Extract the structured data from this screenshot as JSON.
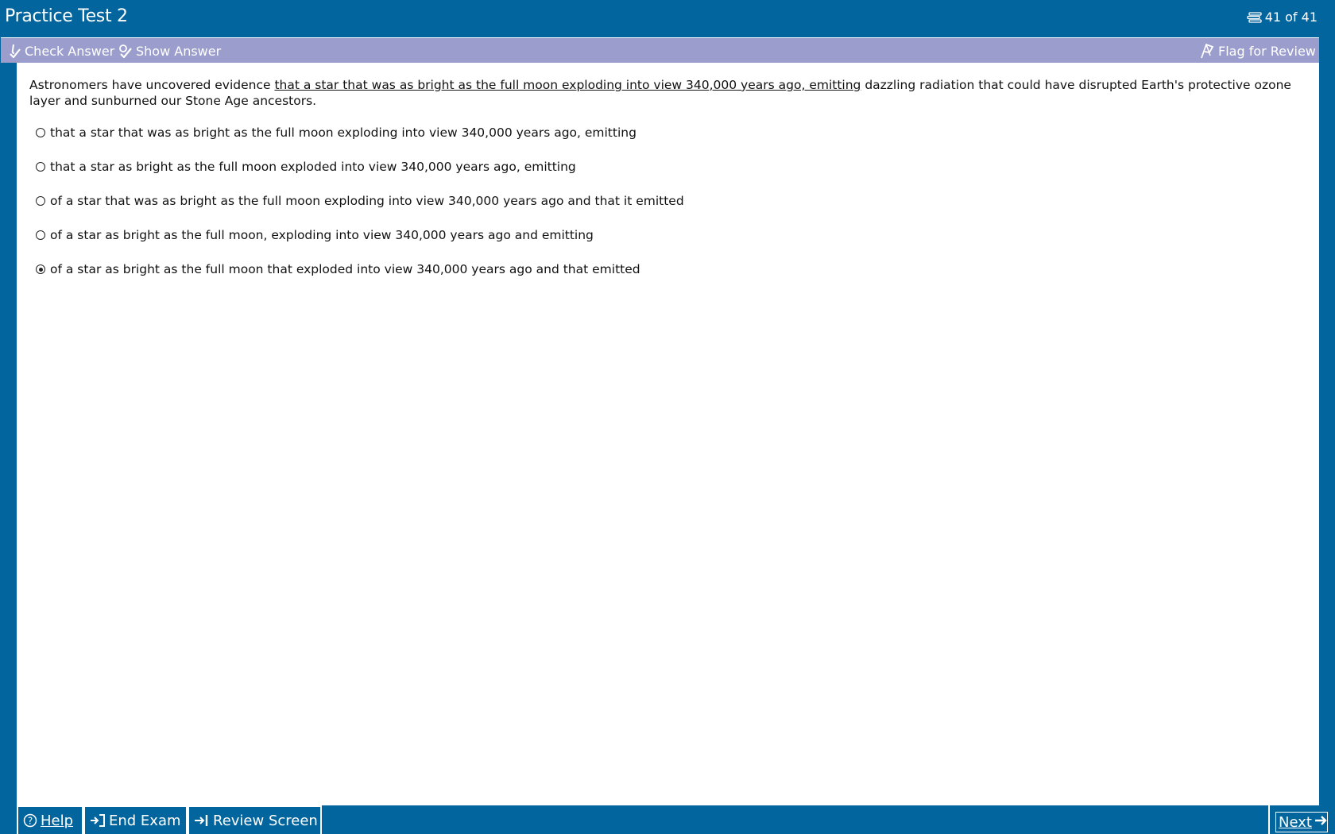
{
  "window": {
    "title": "Practice Test 2",
    "counter": "41 of 41",
    "counter_icon": "list-icon"
  },
  "toolbar": {
    "check_answer": "Check Answer",
    "show_answer": "Show Answer",
    "flag_for_review": "Flag for Review"
  },
  "question": {
    "stem_before": "Astronomers have uncovered evidence ",
    "stem_underlined": "that a star that was as bright as the full moon exploding into view 340,000 years ago, emitting",
    "stem_after": " dazzling radiation that could have disrupted Earth's protective ozone layer and sunburned our Stone Age ancestors.",
    "choices": [
      {
        "text": "that a star that was as bright as the full moon exploding into view 340,000 years ago, emitting",
        "selected": false
      },
      {
        "text": "that a star as bright as the full moon exploded into view 340,000 years ago, emitting",
        "selected": false
      },
      {
        "text": "of a star that was as bright as the full moon exploding into view 340,000 years ago and that it emitted",
        "selected": false
      },
      {
        "text": "of a star as bright as the full moon, exploding into view 340,000 years ago and emitting",
        "selected": false
      },
      {
        "text": "of a star as bright as the full moon that exploded into view 340,000 years ago and that emitted",
        "selected": true
      }
    ]
  },
  "footer": {
    "help": "Help",
    "end_exam": "End Exam",
    "review_screen": "Review Screen",
    "next": "Next"
  },
  "colors": {
    "chrome_blue": "#02659e",
    "toolbar_lavender": "#9b9dcc",
    "content_bg": "#ffffff"
  }
}
